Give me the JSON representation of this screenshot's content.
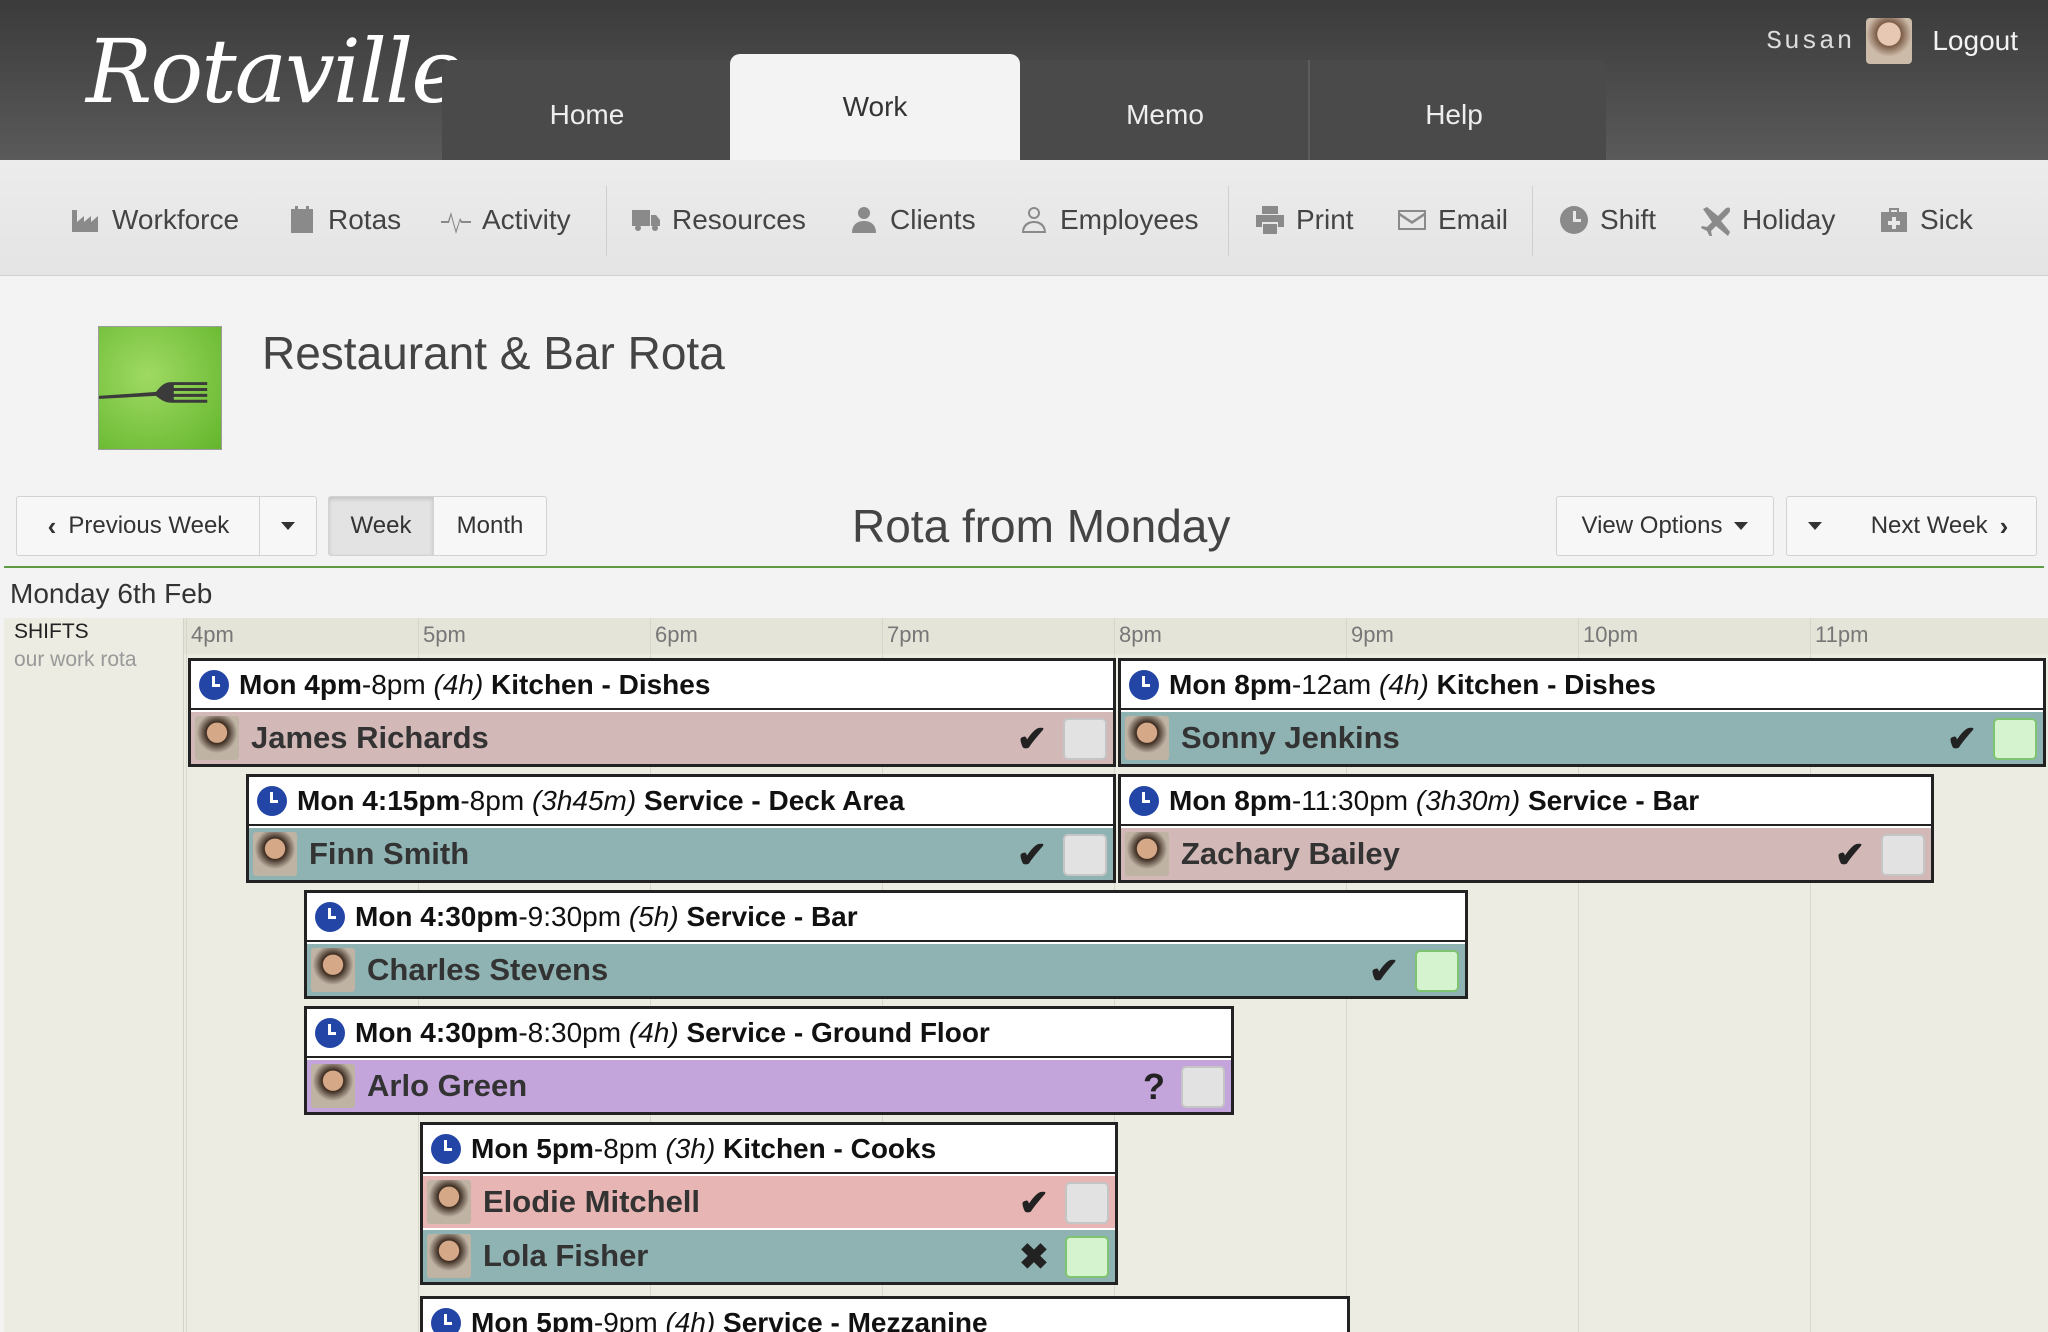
{
  "app": {
    "logo": "Rotaville",
    "user": "Susan",
    "logout_label": "Logout"
  },
  "nav_tabs": [
    {
      "label": "Home"
    },
    {
      "label": "Work",
      "active": true
    },
    {
      "label": "Memo"
    },
    {
      "label": "Help"
    }
  ],
  "toolbar": [
    {
      "label": "Workforce",
      "icon": "factory-icon"
    },
    {
      "label": "Rotas",
      "icon": "list-icon"
    },
    {
      "label": "Activity",
      "icon": "pulse-icon"
    },
    {
      "label": "Resources",
      "icon": "truck-icon"
    },
    {
      "label": "Clients",
      "icon": "client-icon"
    },
    {
      "label": "Employees",
      "icon": "person-icon"
    },
    {
      "label": "Print",
      "icon": "printer-icon"
    },
    {
      "label": "Email",
      "icon": "envelope-icon"
    },
    {
      "label": "Shift",
      "icon": "clock-icon"
    },
    {
      "label": "Holiday",
      "icon": "plane-icon"
    },
    {
      "label": "Sick",
      "icon": "medkit-icon"
    }
  ],
  "rota": {
    "title": "Restaurant & Bar Rota",
    "icon": "fork-icon"
  },
  "controls": {
    "previous_week": "Previous Week",
    "week": "Week",
    "month": "Month",
    "period_title": "Rota from Monday",
    "view_options": "View Options",
    "next_week": "Next Week"
  },
  "grid": {
    "day_label": "Monday 6th Feb",
    "shifts_label": "SHIFTS",
    "shifts_sublabel": "our work rota",
    "hours": [
      "4pm",
      "5pm",
      "6pm",
      "7pm",
      "8pm",
      "9pm",
      "10pm",
      "11pm"
    ]
  },
  "shifts": [
    {
      "start": "Mon 4pm",
      "end": "-8pm",
      "duration": "(4h)",
      "role": "Kitchen - Dishes",
      "employees": [
        {
          "name": "James Richards",
          "status": "✔",
          "confirmed": false,
          "color": "#d3b8b8"
        }
      ]
    },
    {
      "start": "Mon 8pm",
      "end": "-12am",
      "duration": "(4h)",
      "role": "Kitchen - Dishes",
      "employees": [
        {
          "name": "Sonny Jenkins",
          "status": "✔",
          "confirmed": true,
          "color": "#8fb2b2"
        }
      ]
    },
    {
      "start": "Mon 4:15pm",
      "end": "-8pm",
      "duration": "(3h45m)",
      "role": "Service - Deck Area",
      "employees": [
        {
          "name": "Finn Smith",
          "status": "✔",
          "confirmed": false,
          "color": "#8fb2b2"
        }
      ]
    },
    {
      "start": "Mon 8pm",
      "end": "-11:30pm",
      "duration": "(3h30m)",
      "role": "Service - Bar",
      "employees": [
        {
          "name": "Zachary Bailey",
          "status": "✔",
          "confirmed": false,
          "color": "#d3b8b8"
        }
      ]
    },
    {
      "start": "Mon 4:30pm",
      "end": "-9:30pm",
      "duration": "(5h)",
      "role": "Service - Bar",
      "employees": [
        {
          "name": "Charles Stevens",
          "status": "✔",
          "confirmed": true,
          "color": "#8fb2b2"
        }
      ]
    },
    {
      "start": "Mon 4:30pm",
      "end": "-8:30pm",
      "duration": "(4h)",
      "role": "Service - Ground Floor",
      "employees": [
        {
          "name": "Arlo Green",
          "status": "?",
          "confirmed": false,
          "color": "#c3a4db"
        }
      ]
    },
    {
      "start": "Mon 5pm",
      "end": "-8pm",
      "duration": "(3h)",
      "role": "Kitchen - Cooks",
      "employees": [
        {
          "name": "Elodie Mitchell",
          "status": "✔",
          "confirmed": false,
          "color": "#e7b5b3"
        },
        {
          "name": "Lola Fisher",
          "status": "✖",
          "confirmed": true,
          "color": "#8fb2b2"
        }
      ]
    },
    {
      "start": "Mon 5pm",
      "end": "-9pm",
      "duration": "(4h)",
      "role": "Service - Mezzanine",
      "employees": []
    }
  ]
}
